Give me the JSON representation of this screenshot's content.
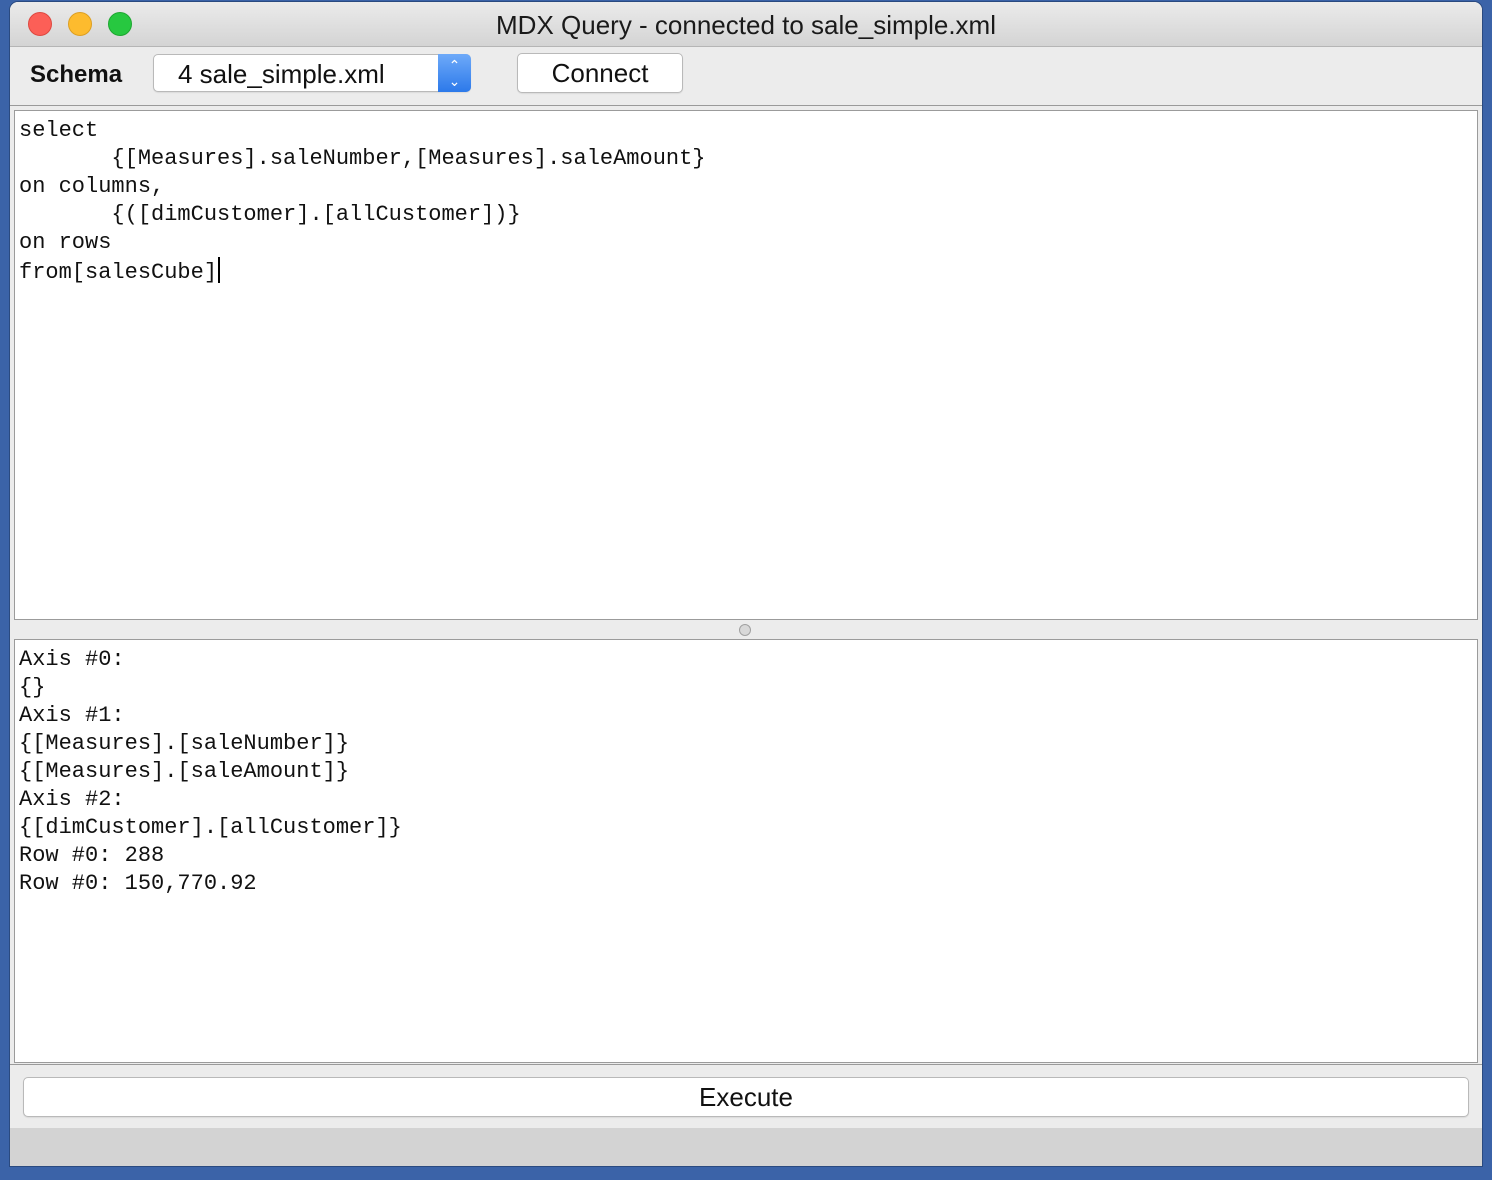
{
  "window": {
    "title": "MDX Query - connected to sale_simple.xml"
  },
  "toolbar": {
    "schema_label": "Schema",
    "schema_selected": "4 sale_simple.xml",
    "connect_label": "Connect"
  },
  "query_editor": {
    "lines": [
      "select",
      "       {[Measures].saleNumber,[Measures].saleAmount}",
      "on columns,",
      "       {([dimCustomer].[allCustomer])}",
      "on rows",
      "from[salesCube]"
    ]
  },
  "result_output": {
    "lines": [
      "Axis #0:",
      "{}",
      "Axis #1:",
      "{[Measures].[saleNumber]}",
      "{[Measures].[saleAmount]}",
      "Axis #2:",
      "{[dimCustomer].[allCustomer]}",
      "Row #0: 288",
      "Row #0: 150,770.92"
    ]
  },
  "footer": {
    "execute_label": "Execute"
  },
  "icons": {
    "select_arrows": "up-down-chevron-icon",
    "window_controls": [
      "close-icon",
      "minimize-icon",
      "maximize-icon"
    ]
  }
}
